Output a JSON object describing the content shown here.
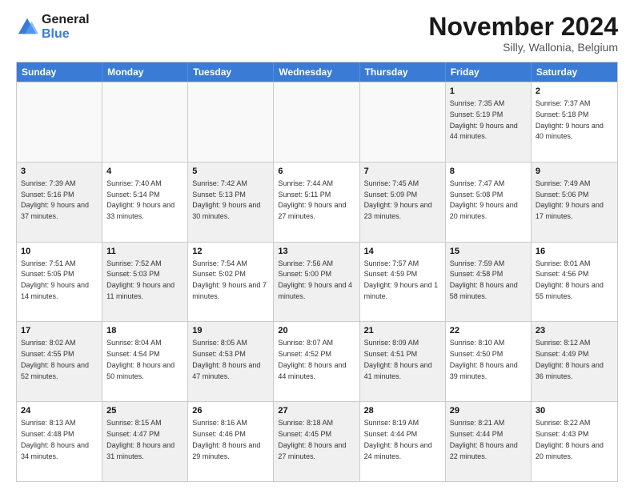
{
  "logo": {
    "line1": "General",
    "line2": "Blue"
  },
  "title": "November 2024",
  "location": "Silly, Wallonia, Belgium",
  "header_days": [
    "Sunday",
    "Monday",
    "Tuesday",
    "Wednesday",
    "Thursday",
    "Friday",
    "Saturday"
  ],
  "rows": [
    [
      {
        "day": "",
        "info": "",
        "shaded": false,
        "empty": true
      },
      {
        "day": "",
        "info": "",
        "shaded": false,
        "empty": true
      },
      {
        "day": "",
        "info": "",
        "shaded": false,
        "empty": true
      },
      {
        "day": "",
        "info": "",
        "shaded": false,
        "empty": true
      },
      {
        "day": "",
        "info": "",
        "shaded": false,
        "empty": true
      },
      {
        "day": "1",
        "info": "Sunrise: 7:35 AM\nSunset: 5:19 PM\nDaylight: 9 hours and 44 minutes.",
        "shaded": true,
        "empty": false
      },
      {
        "day": "2",
        "info": "Sunrise: 7:37 AM\nSunset: 5:18 PM\nDaylight: 9 hours and 40 minutes.",
        "shaded": false,
        "empty": false
      }
    ],
    [
      {
        "day": "3",
        "info": "Sunrise: 7:39 AM\nSunset: 5:16 PM\nDaylight: 9 hours and 37 minutes.",
        "shaded": true,
        "empty": false
      },
      {
        "day": "4",
        "info": "Sunrise: 7:40 AM\nSunset: 5:14 PM\nDaylight: 9 hours and 33 minutes.",
        "shaded": false,
        "empty": false
      },
      {
        "day": "5",
        "info": "Sunrise: 7:42 AM\nSunset: 5:13 PM\nDaylight: 9 hours and 30 minutes.",
        "shaded": true,
        "empty": false
      },
      {
        "day": "6",
        "info": "Sunrise: 7:44 AM\nSunset: 5:11 PM\nDaylight: 9 hours and 27 minutes.",
        "shaded": false,
        "empty": false
      },
      {
        "day": "7",
        "info": "Sunrise: 7:45 AM\nSunset: 5:09 PM\nDaylight: 9 hours and 23 minutes.",
        "shaded": true,
        "empty": false
      },
      {
        "day": "8",
        "info": "Sunrise: 7:47 AM\nSunset: 5:08 PM\nDaylight: 9 hours and 20 minutes.",
        "shaded": false,
        "empty": false
      },
      {
        "day": "9",
        "info": "Sunrise: 7:49 AM\nSunset: 5:06 PM\nDaylight: 9 hours and 17 minutes.",
        "shaded": true,
        "empty": false
      }
    ],
    [
      {
        "day": "10",
        "info": "Sunrise: 7:51 AM\nSunset: 5:05 PM\nDaylight: 9 hours and 14 minutes.",
        "shaded": false,
        "empty": false
      },
      {
        "day": "11",
        "info": "Sunrise: 7:52 AM\nSunset: 5:03 PM\nDaylight: 9 hours and 11 minutes.",
        "shaded": true,
        "empty": false
      },
      {
        "day": "12",
        "info": "Sunrise: 7:54 AM\nSunset: 5:02 PM\nDaylight: 9 hours and 7 minutes.",
        "shaded": false,
        "empty": false
      },
      {
        "day": "13",
        "info": "Sunrise: 7:56 AM\nSunset: 5:00 PM\nDaylight: 9 hours and 4 minutes.",
        "shaded": true,
        "empty": false
      },
      {
        "day": "14",
        "info": "Sunrise: 7:57 AM\nSunset: 4:59 PM\nDaylight: 9 hours and 1 minute.",
        "shaded": false,
        "empty": false
      },
      {
        "day": "15",
        "info": "Sunrise: 7:59 AM\nSunset: 4:58 PM\nDaylight: 8 hours and 58 minutes.",
        "shaded": true,
        "empty": false
      },
      {
        "day": "16",
        "info": "Sunrise: 8:01 AM\nSunset: 4:56 PM\nDaylight: 8 hours and 55 minutes.",
        "shaded": false,
        "empty": false
      }
    ],
    [
      {
        "day": "17",
        "info": "Sunrise: 8:02 AM\nSunset: 4:55 PM\nDaylight: 8 hours and 52 minutes.",
        "shaded": true,
        "empty": false
      },
      {
        "day": "18",
        "info": "Sunrise: 8:04 AM\nSunset: 4:54 PM\nDaylight: 8 hours and 50 minutes.",
        "shaded": false,
        "empty": false
      },
      {
        "day": "19",
        "info": "Sunrise: 8:05 AM\nSunset: 4:53 PM\nDaylight: 8 hours and 47 minutes.",
        "shaded": true,
        "empty": false
      },
      {
        "day": "20",
        "info": "Sunrise: 8:07 AM\nSunset: 4:52 PM\nDaylight: 8 hours and 44 minutes.",
        "shaded": false,
        "empty": false
      },
      {
        "day": "21",
        "info": "Sunrise: 8:09 AM\nSunset: 4:51 PM\nDaylight: 8 hours and 41 minutes.",
        "shaded": true,
        "empty": false
      },
      {
        "day": "22",
        "info": "Sunrise: 8:10 AM\nSunset: 4:50 PM\nDaylight: 8 hours and 39 minutes.",
        "shaded": false,
        "empty": false
      },
      {
        "day": "23",
        "info": "Sunrise: 8:12 AM\nSunset: 4:49 PM\nDaylight: 8 hours and 36 minutes.",
        "shaded": true,
        "empty": false
      }
    ],
    [
      {
        "day": "24",
        "info": "Sunrise: 8:13 AM\nSunset: 4:48 PM\nDaylight: 8 hours and 34 minutes.",
        "shaded": false,
        "empty": false
      },
      {
        "day": "25",
        "info": "Sunrise: 8:15 AM\nSunset: 4:47 PM\nDaylight: 8 hours and 31 minutes.",
        "shaded": true,
        "empty": false
      },
      {
        "day": "26",
        "info": "Sunrise: 8:16 AM\nSunset: 4:46 PM\nDaylight: 8 hours and 29 minutes.",
        "shaded": false,
        "empty": false
      },
      {
        "day": "27",
        "info": "Sunrise: 8:18 AM\nSunset: 4:45 PM\nDaylight: 8 hours and 27 minutes.",
        "shaded": true,
        "empty": false
      },
      {
        "day": "28",
        "info": "Sunrise: 8:19 AM\nSunset: 4:44 PM\nDaylight: 8 hours and 24 minutes.",
        "shaded": false,
        "empty": false
      },
      {
        "day": "29",
        "info": "Sunrise: 8:21 AM\nSunset: 4:44 PM\nDaylight: 8 hours and 22 minutes.",
        "shaded": true,
        "empty": false
      },
      {
        "day": "30",
        "info": "Sunrise: 8:22 AM\nSunset: 4:43 PM\nDaylight: 8 hours and 20 minutes.",
        "shaded": false,
        "empty": false
      }
    ]
  ]
}
